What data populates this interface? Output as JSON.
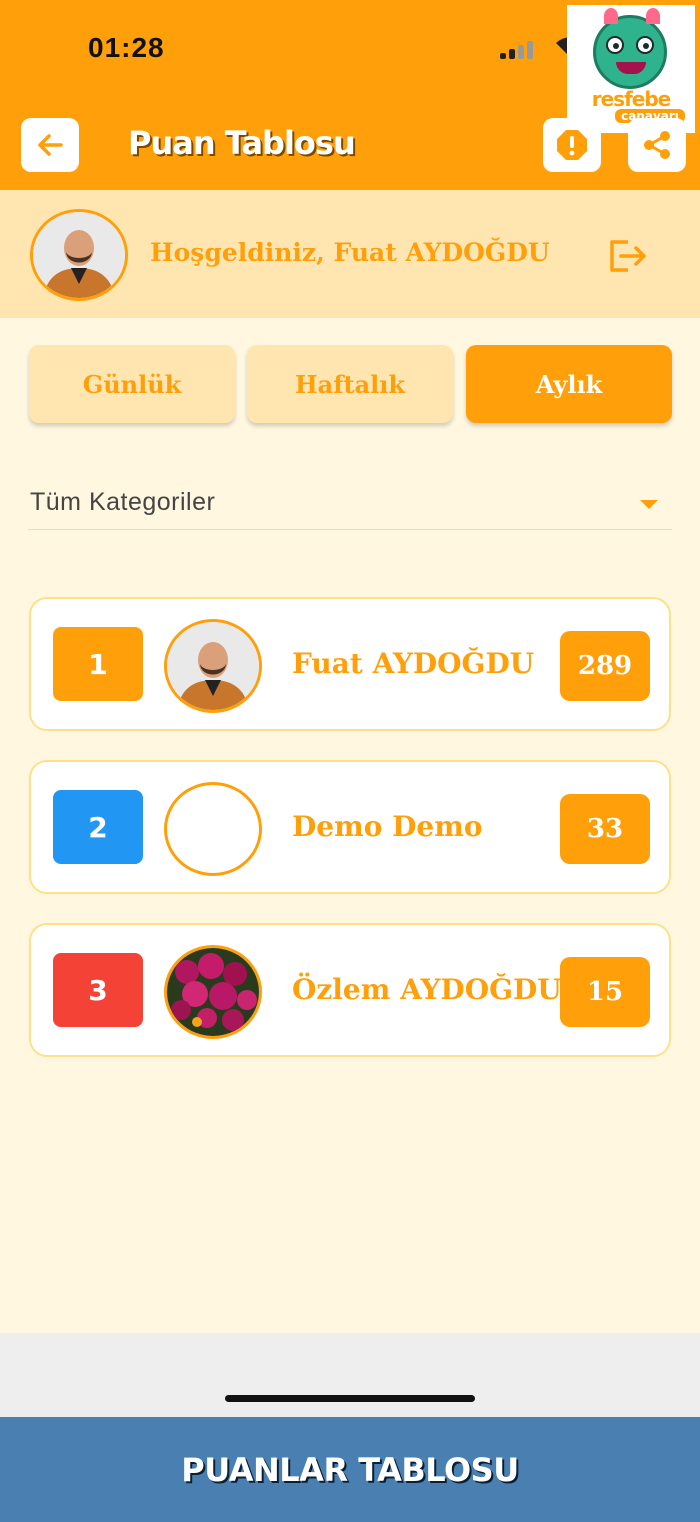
{
  "status_bar": {
    "time": "01:28"
  },
  "logo": {
    "line1": "resfebe",
    "line2": "canavarı"
  },
  "header": {
    "title": "Puan Tablosu"
  },
  "welcome": {
    "text": "Hoşgeldiniz, Fuat AYDOĞDU"
  },
  "tabs": [
    {
      "label": "Günlük",
      "active": false
    },
    {
      "label": "Haftalık",
      "active": false
    },
    {
      "label": "Aylık",
      "active": true
    }
  ],
  "category_select": {
    "selected": "Tüm Kategoriler"
  },
  "leaderboard": [
    {
      "rank": "1",
      "name": "Fuat AYDOĞDU",
      "score": "289",
      "rank_color": "#ff9f0a"
    },
    {
      "rank": "2",
      "name": "Demo Demo",
      "score": "33",
      "rank_color": "#2196f3"
    },
    {
      "rank": "3",
      "name": "Özlem AYDOĞDU",
      "score": "15",
      "rank_color": "#f44336"
    }
  ],
  "bottom_bar": {
    "label": "PUANLAR TABLOSU"
  },
  "colors": {
    "primary": "#ff9f0a",
    "light": "#ffe6b0",
    "background": "#fff7e0",
    "bottom_bar": "#4a7fb1"
  }
}
